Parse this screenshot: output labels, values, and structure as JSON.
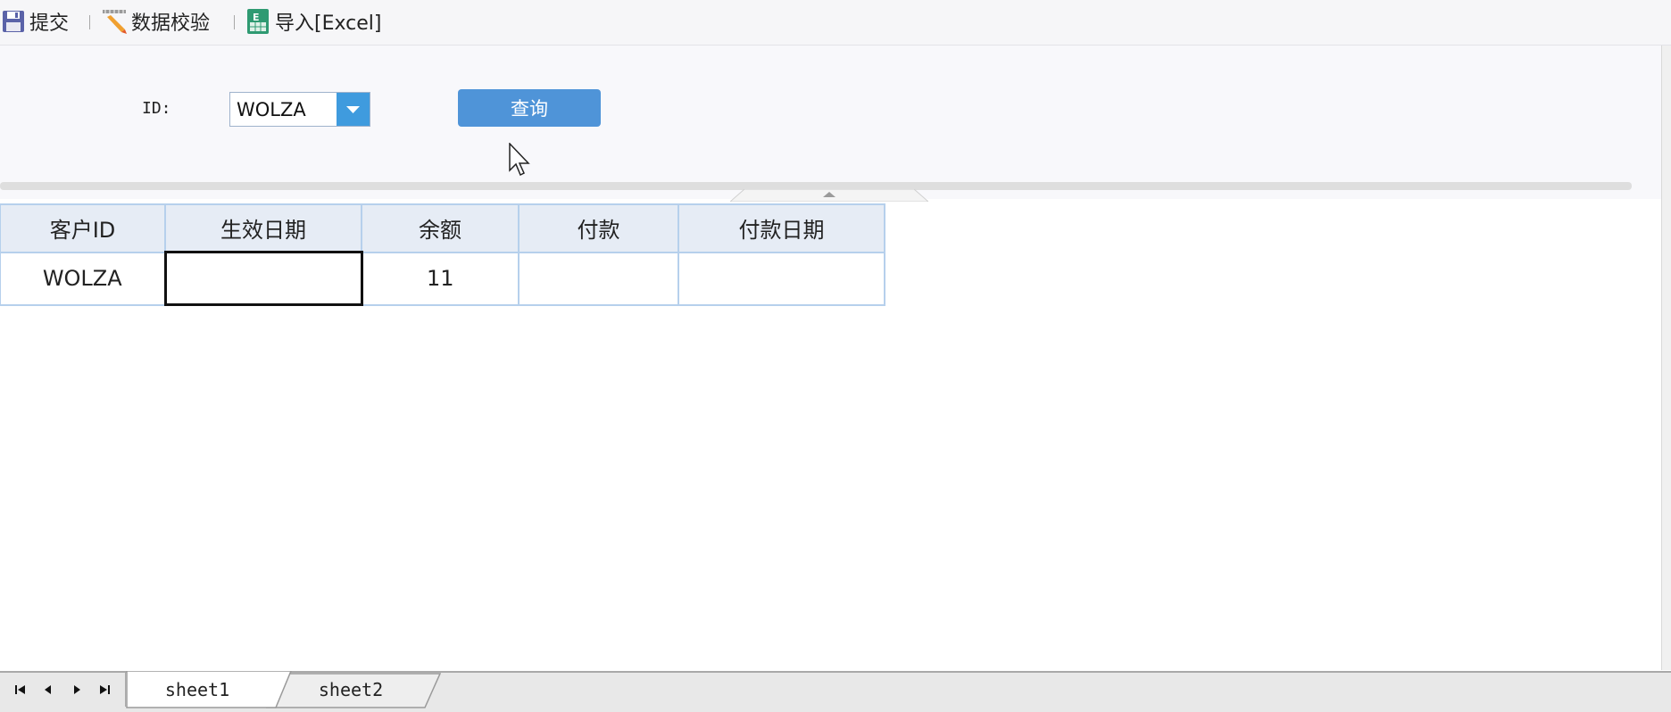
{
  "toolbar": {
    "submit_label": "提交",
    "validate_label": "数据校验",
    "import_label": "导入[Excel]"
  },
  "params": {
    "id_label": "ID:",
    "id_value": "WOLZA",
    "query_label": "查询"
  },
  "table": {
    "headers": [
      "客户ID",
      "生效日期",
      "余额",
      "付款",
      "付款日期"
    ],
    "rows": [
      [
        "WOLZA",
        "",
        "11",
        "",
        ""
      ]
    ]
  },
  "sheets": {
    "tabs": [
      "sheet1",
      "sheet2"
    ],
    "active": "sheet1"
  },
  "colors": {
    "accent": "#4f94d8",
    "grid_border": "#b6d0ec",
    "header_bg": "#e6ecf5"
  }
}
